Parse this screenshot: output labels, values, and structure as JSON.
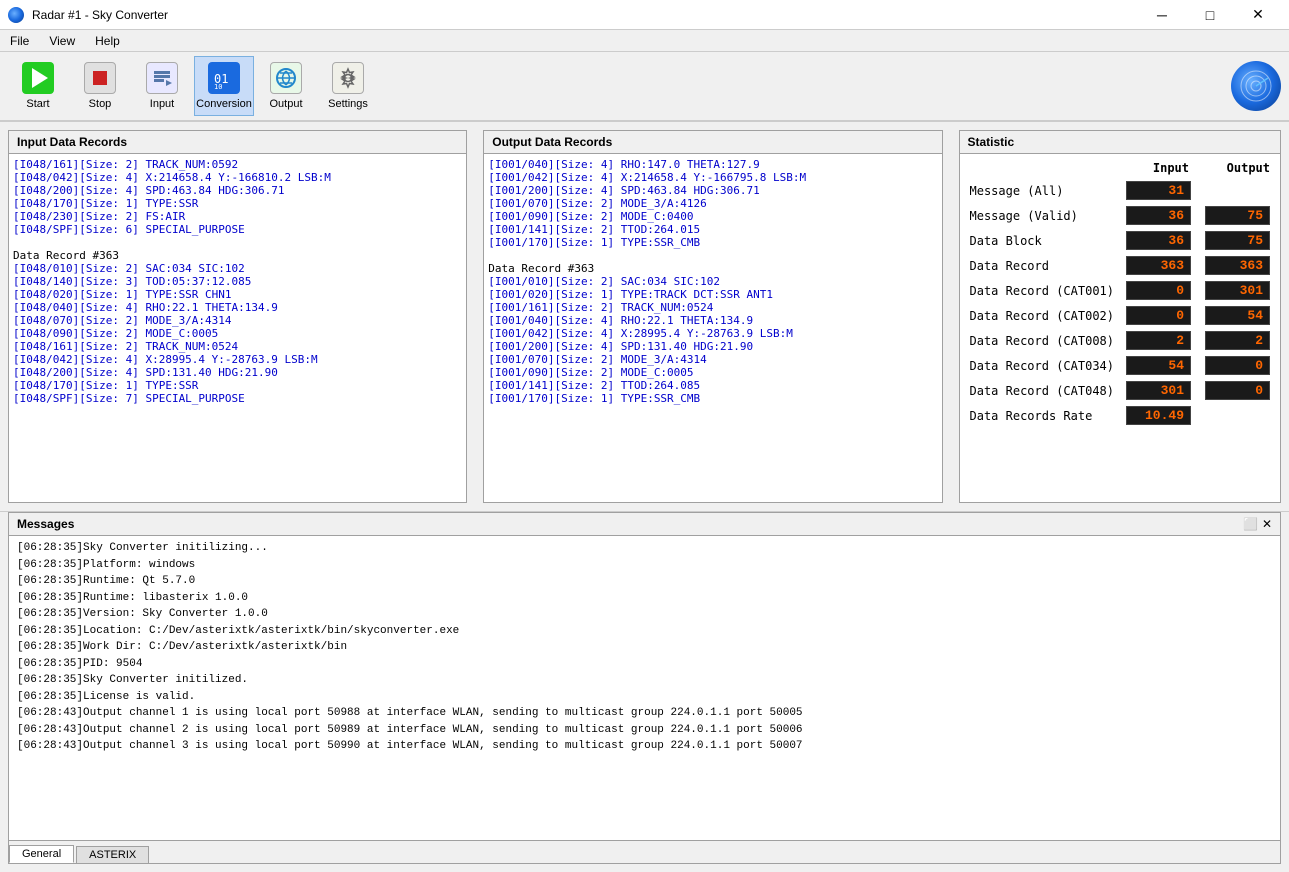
{
  "titlebar": {
    "title": "Radar #1 - Sky Converter",
    "icon": "radar-app-icon",
    "minimize_label": "─",
    "maximize_label": "□",
    "close_label": "✕"
  },
  "menubar": {
    "items": [
      {
        "id": "file",
        "label": "File"
      },
      {
        "id": "view",
        "label": "View"
      },
      {
        "id": "help",
        "label": "Help"
      }
    ]
  },
  "toolbar": {
    "buttons": [
      {
        "id": "start",
        "label": "Start",
        "icon": "play-icon",
        "active": false
      },
      {
        "id": "stop",
        "label": "Stop",
        "icon": "stop-icon",
        "active": false
      },
      {
        "id": "input",
        "label": "Input",
        "icon": "input-icon",
        "active": false
      },
      {
        "id": "conversion",
        "label": "Conversion",
        "icon": "conversion-icon",
        "active": true
      },
      {
        "id": "output",
        "label": "Output",
        "icon": "output-icon",
        "active": false
      },
      {
        "id": "settings",
        "label": "Settings",
        "icon": "settings-icon",
        "active": false
      }
    ]
  },
  "input_panel": {
    "title": "Input Data Records",
    "lines": [
      {
        "text": "[I048/161][Size: 2] TRACK_NUM:0592",
        "color": "blue"
      },
      {
        "text": "[I048/042][Size: 4] X:214658.4 Y:-166810.2 LSB:M",
        "color": "blue"
      },
      {
        "text": "[I048/200][Size: 4] SPD:463.84 HDG:306.71",
        "color": "blue"
      },
      {
        "text": "[I048/170][Size: 1] TYPE:SSR",
        "color": "blue"
      },
      {
        "text": "[I048/230][Size: 2] FS:AIR",
        "color": "blue"
      },
      {
        "text": "[I048/SPF][Size: 6] SPECIAL_PURPOSE",
        "color": "blue"
      },
      {
        "text": "",
        "color": "normal"
      },
      {
        "text": "Data Record #363",
        "color": "normal"
      },
      {
        "text": "[I048/010][Size: 2] SAC:034 SIC:102",
        "color": "blue"
      },
      {
        "text": "[I048/140][Size: 3] TOD:05:37:12.085",
        "color": "blue"
      },
      {
        "text": "[I048/020][Size: 1] TYPE:SSR CHN1",
        "color": "blue"
      },
      {
        "text": "[I048/040][Size: 4] RHO:22.1 THETA:134.9",
        "color": "blue"
      },
      {
        "text": "[I048/070][Size: 2] MODE_3/A:4314",
        "color": "blue"
      },
      {
        "text": "[I048/090][Size: 2] MODE_C:0005",
        "color": "blue"
      },
      {
        "text": "[I048/161][Size: 2] TRACK_NUM:0524",
        "color": "blue"
      },
      {
        "text": "[I048/042][Size: 4] X:28995.4 Y:-28763.9 LSB:M",
        "color": "blue"
      },
      {
        "text": "[I048/200][Size: 4] SPD:131.40 HDG:21.90",
        "color": "blue"
      },
      {
        "text": "[I048/170][Size: 1] TYPE:SSR",
        "color": "blue"
      },
      {
        "text": "[I048/SPF][Size: 7] SPECIAL_PURPOSE",
        "color": "blue"
      }
    ]
  },
  "output_panel": {
    "title": "Output Data Records",
    "lines": [
      {
        "text": "[I001/040][Size: 4] RHO:147.0 THETA:127.9",
        "color": "blue"
      },
      {
        "text": "[I001/042][Size: 4] X:214658.4 Y:-166795.8 LSB:M",
        "color": "blue"
      },
      {
        "text": "[I001/200][Size: 4] SPD:463.84 HDG:306.71",
        "color": "blue"
      },
      {
        "text": "[I001/070][Size: 2] MODE_3/A:4126",
        "color": "blue"
      },
      {
        "text": "[I001/090][Size: 2] MODE_C:0400",
        "color": "blue"
      },
      {
        "text": "[I001/141][Size: 2] TTOD:264.015",
        "color": "blue"
      },
      {
        "text": "[I001/170][Size: 1] TYPE:SSR_CMB",
        "color": "blue"
      },
      {
        "text": "",
        "color": "normal"
      },
      {
        "text": "Data Record #363",
        "color": "normal"
      },
      {
        "text": "[I001/010][Size: 2] SAC:034 SIC:102",
        "color": "blue"
      },
      {
        "text": "[I001/020][Size: 1] TYPE:TRACK DCT:SSR ANT1",
        "color": "blue"
      },
      {
        "text": "[I001/161][Size: 2] TRACK_NUM:0524",
        "color": "blue"
      },
      {
        "text": "[I001/040][Size: 4] RHO:22.1 THETA:134.9",
        "color": "blue"
      },
      {
        "text": "[I001/042][Size: 4] X:28995.4 Y:-28763.9 LSB:M",
        "color": "blue"
      },
      {
        "text": "[I001/200][Size: 4] SPD:131.40 HDG:21.90",
        "color": "blue"
      },
      {
        "text": "[I001/070][Size: 2] MODE_3/A:4314",
        "color": "blue"
      },
      {
        "text": "[I001/090][Size: 2] MODE_C:0005",
        "color": "blue"
      },
      {
        "text": "[I001/141][Size: 2] TTOD:264.085",
        "color": "blue"
      },
      {
        "text": "[I001/170][Size: 1] TYPE:SSR_CMB",
        "color": "blue"
      }
    ]
  },
  "statistic_panel": {
    "title": "Statistic",
    "col_input": "Input",
    "col_output": "Output",
    "rows": [
      {
        "label": "Message (All)",
        "input": "31",
        "output": ""
      },
      {
        "label": "Message (Valid)",
        "input": "36",
        "output": "75"
      },
      {
        "label": "Data Block",
        "input": "36",
        "output": "75"
      },
      {
        "label": "Data Record",
        "input": "363",
        "output": "363"
      },
      {
        "label": "Data Record (CAT001)",
        "input": "0",
        "output": "301"
      },
      {
        "label": "Data Record (CAT002)",
        "input": "0",
        "output": "54"
      },
      {
        "label": "Data Record (CAT008)",
        "input": "2",
        "output": "2"
      },
      {
        "label": "Data Record (CAT034)",
        "input": "54",
        "output": "0"
      },
      {
        "label": "Data Record (CAT048)",
        "input": "301",
        "output": "0"
      },
      {
        "label": "Data Records Rate",
        "input": "10.49",
        "output": ""
      }
    ]
  },
  "messages_panel": {
    "title": "Messages",
    "lines": [
      "[06:28:35]Sky Converter initilizing...",
      "[06:28:35]Platform: windows",
      "[06:28:35]Runtime: Qt 5.7.0",
      "[06:28:35]Runtime: libasterix 1.0.0",
      "[06:28:35]Version: Sky Converter 1.0.0",
      "[06:28:35]Location: C:/Dev/asterixtk/asterixtk/bin/skyconverter.exe",
      "[06:28:35]Work Dir: C:/Dev/asterixtk/asterixtk/bin",
      "[06:28:35]PID: 9504",
      "[06:28:35]Sky Converter initilized.",
      "[06:28:35]License is valid.",
      "[06:28:43]Output channel 1 is using local port 50988 at interface WLAN, sending to multicast group 224.0.1.1 port 50005",
      "[06:28:43]Output channel 2 is using local port 50989 at interface WLAN, sending to multicast group 224.0.1.1 port 50006",
      "[06:28:43]Output channel 3 is using local port 50990 at interface WLAN, sending to multicast group 224.0.1.1 port 50007"
    ],
    "tabs": [
      {
        "id": "general",
        "label": "General",
        "active": true
      },
      {
        "id": "asterix",
        "label": "ASTERIX",
        "active": false
      }
    ],
    "controls": {
      "expand": "⬜",
      "close": "✕"
    }
  }
}
